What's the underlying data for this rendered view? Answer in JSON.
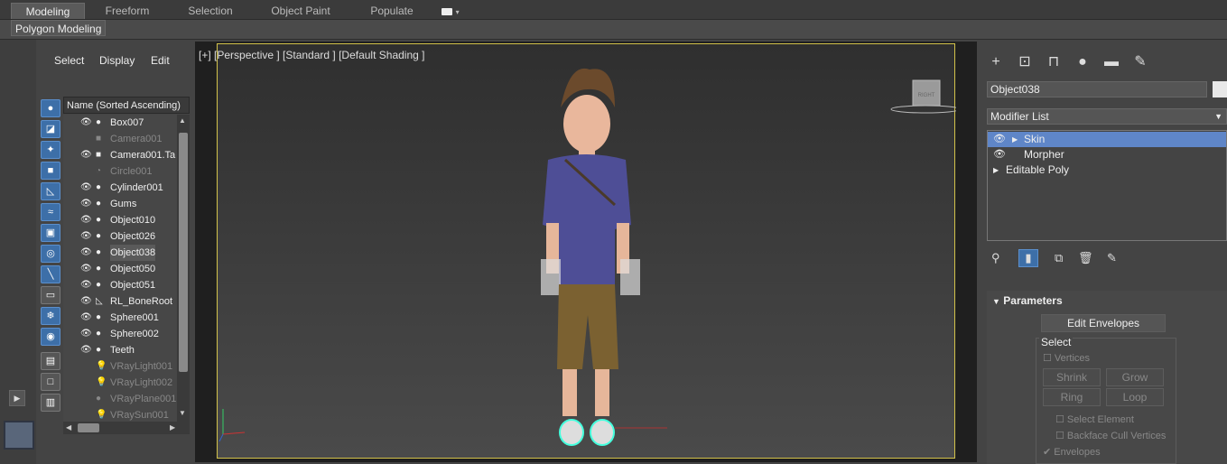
{
  "ribbon": {
    "tabs": [
      {
        "label": "Modeling",
        "active": true
      },
      {
        "label": "Freeform"
      },
      {
        "label": "Selection"
      },
      {
        "label": "Object Paint"
      },
      {
        "label": "Populate"
      }
    ],
    "sub_tab": "Polygon Modeling"
  },
  "explorer": {
    "menu": [
      "Select",
      "Display",
      "Edit"
    ],
    "column_header": "Name (Sorted Ascending)",
    "rows": [
      {
        "name": "Box007",
        "dim": false,
        "icon": "eye"
      },
      {
        "name": "Camera001",
        "dim": true,
        "icon": "camera"
      },
      {
        "name": "Camera001.Ta",
        "dim": false,
        "icon": "camera"
      },
      {
        "name": "Circle001",
        "dim": true,
        "icon": "shape"
      },
      {
        "name": "Cylinder001",
        "dim": false,
        "icon": "geometry"
      },
      {
        "name": "Gums",
        "dim": false,
        "icon": "geometry"
      },
      {
        "name": "Object010",
        "dim": false,
        "icon": "geometry"
      },
      {
        "name": "Object026",
        "dim": false,
        "icon": "geometry"
      },
      {
        "name": "Object038",
        "dim": false,
        "icon": "geometry",
        "selected": true
      },
      {
        "name": "Object050",
        "dim": false,
        "icon": "geometry"
      },
      {
        "name": "Object051",
        "dim": false,
        "icon": "geometry"
      },
      {
        "name": "RL_BoneRoot",
        "dim": false,
        "icon": "bone"
      },
      {
        "name": "Sphere001",
        "dim": false,
        "icon": "geometry"
      },
      {
        "name": "Sphere002",
        "dim": false,
        "icon": "geometry"
      },
      {
        "name": "Teeth",
        "dim": false,
        "icon": "geometry"
      },
      {
        "name": "VRayLight001",
        "dim": true,
        "icon": "light"
      },
      {
        "name": "VRayLight002",
        "dim": true,
        "icon": "light"
      },
      {
        "name": "VRayPlane001",
        "dim": true,
        "icon": "geometry"
      },
      {
        "name": "VRaySun001",
        "dim": true,
        "icon": "light"
      }
    ]
  },
  "viewport": {
    "label": "[+] [Perspective ] [Standard ] [Default Shading ]",
    "viewcube_label": "RIGHT"
  },
  "command_panel": {
    "object_name": "Object038",
    "modifier_list": "Modifier List",
    "stack": [
      {
        "label": "Skin",
        "selected": true
      },
      {
        "label": "Morpher"
      },
      {
        "label": "Editable Poly"
      }
    ],
    "rollout_title": "Parameters",
    "edit_envelopes": "Edit Envelopes",
    "select_group": "Select",
    "vertices": "Vertices",
    "shrink": "Shrink",
    "grow": "Grow",
    "ring": "Ring",
    "loop": "Loop",
    "select_element": "Select Element",
    "backface_cull": "Backface Cull Vertices",
    "envelopes": "Envelopes"
  }
}
